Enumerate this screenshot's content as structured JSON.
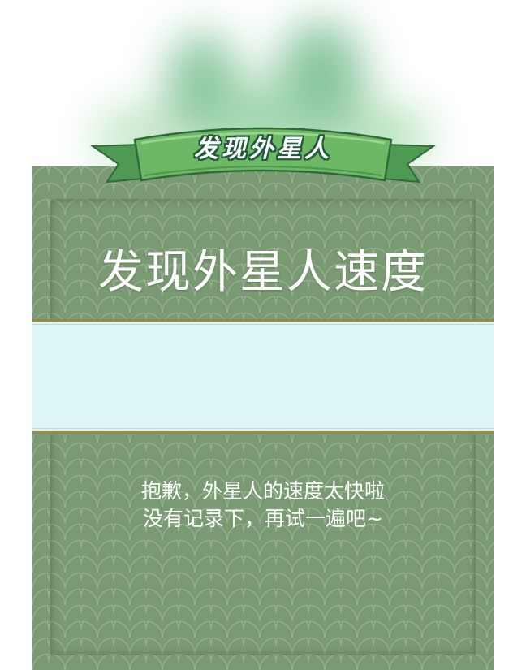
{
  "banner": {
    "title": "发现外星人"
  },
  "panel": {
    "heading": "发现外星人速度",
    "result_value": "",
    "message_line1": "抱歉，外星人的速度太快啦",
    "message_line2": "没有记录下，再试一遍吧~"
  },
  "colors": {
    "panel_green": "#7a9a73",
    "band_light": "#dcf5f6",
    "band_border": "#9a8a3a",
    "banner_green": "#5fa65a",
    "banner_outline": "#1f5a3a"
  },
  "icons": {
    "ribbon": "ribbon-banner-icon"
  }
}
